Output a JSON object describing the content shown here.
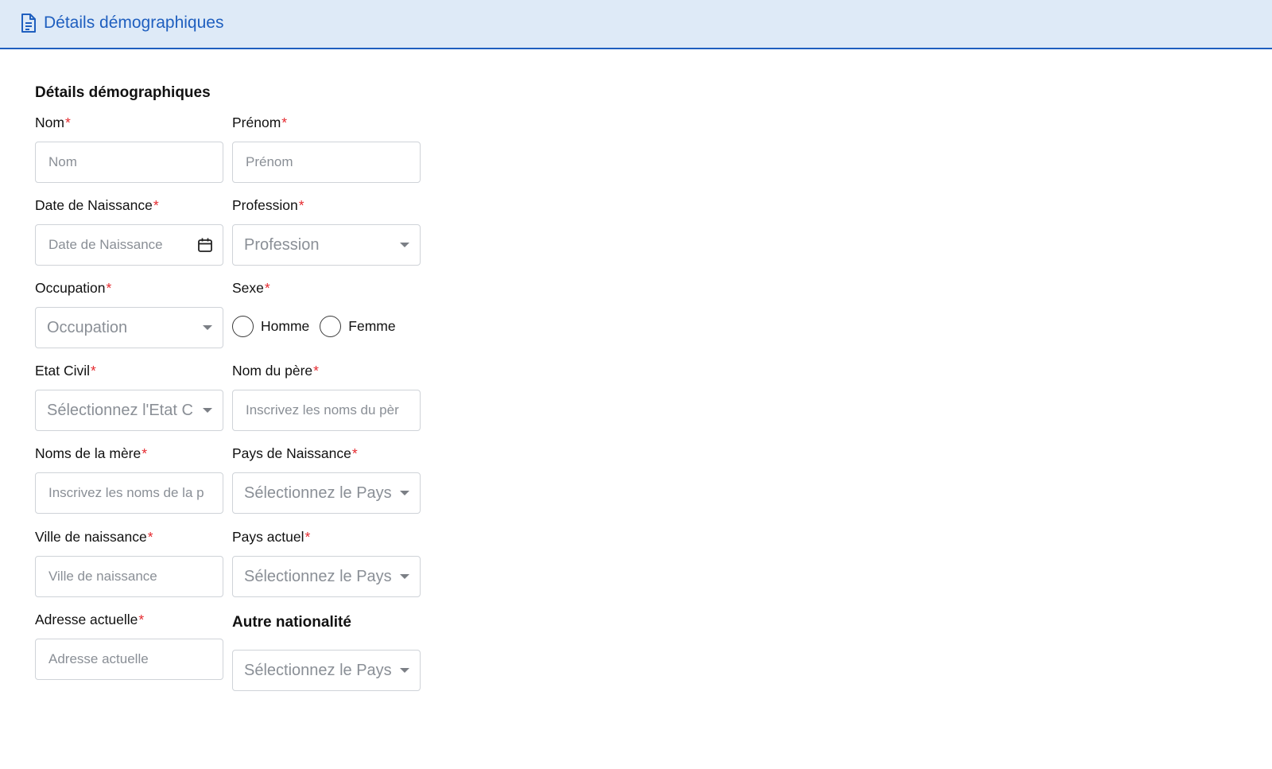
{
  "tab": {
    "label": "Détails démographiques"
  },
  "section": {
    "title": "Détails démographiques"
  },
  "fields": {
    "nom": {
      "label": "Nom",
      "required": "*",
      "placeholder": "Nom"
    },
    "prenom": {
      "label": "Prénom",
      "required": "*",
      "placeholder": "Prénom"
    },
    "date_naissance": {
      "label": "Date de Naissance",
      "required": "*",
      "placeholder": "Date de Naissance"
    },
    "profession": {
      "label": "Profession",
      "required": "*",
      "value": "Profession"
    },
    "occupation": {
      "label": "Occupation",
      "required": "*",
      "value": "Occupation"
    },
    "sexe": {
      "label": "Sexe",
      "required": "*",
      "options": [
        "Homme",
        "Femme"
      ]
    },
    "etat_civil": {
      "label": "Etat Civil",
      "required": "*",
      "value": "Sélectionnez l'Etat C"
    },
    "nom_pere": {
      "label": "Nom du père",
      "required": "*",
      "placeholder": "Inscrivez les noms du pèr"
    },
    "noms_mere": {
      "label": "Noms de la mère",
      "required": "*",
      "placeholder": "Inscrivez les noms de la p"
    },
    "pays_naissance": {
      "label": "Pays de Naissance",
      "required": "*",
      "value": "Sélectionnez le Pays"
    },
    "ville_naissance": {
      "label": "Ville de naissance",
      "required": "*",
      "placeholder": "Ville de naissance"
    },
    "pays_actuel": {
      "label": "Pays actuel",
      "required": "*",
      "value": "Sélectionnez le Pays"
    },
    "adresse_actuelle": {
      "label": "Adresse actuelle",
      "required": "*",
      "placeholder": "Adresse actuelle"
    },
    "autre_nationalite": {
      "label": "Autre nationalité",
      "value": "Sélectionnez le Pays"
    }
  },
  "colors": {
    "accent": "#1f5fbf",
    "tab_bg": "#deeaf7",
    "required": "#e5292e",
    "border": "#cfd3d8"
  },
  "icons": {
    "tab": "document-icon",
    "date": "calendar-icon",
    "select": "caret-down-icon"
  }
}
